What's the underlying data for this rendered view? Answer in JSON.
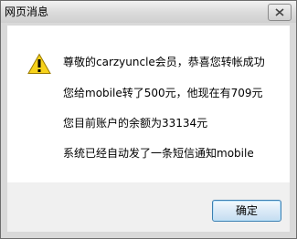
{
  "window": {
    "title": "网页消息"
  },
  "icons": {
    "warning": "warning-triangle-icon",
    "close": "close-icon"
  },
  "message": {
    "lines": [
      "尊敬的carzyuncle会员，恭喜您转帐成功",
      "您给mobile转了500元，他现在有709元",
      "您目前账户的余额为33134元",
      "系统已经自动发了一条短信通知mobile"
    ]
  },
  "buttons": {
    "ok_label": "确定"
  }
}
